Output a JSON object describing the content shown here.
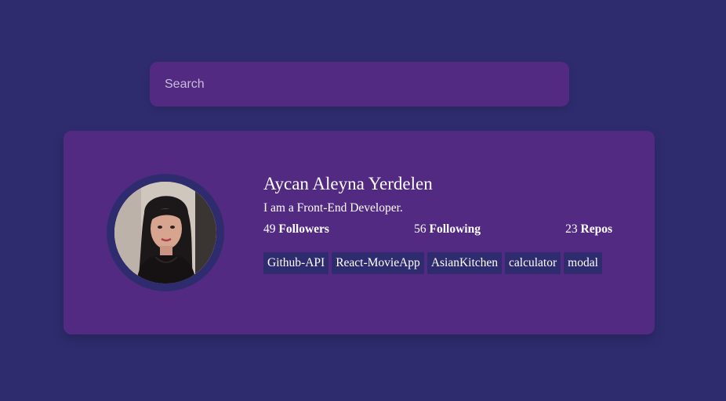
{
  "search": {
    "placeholder": "Search",
    "value": ""
  },
  "user": {
    "name": "Aycan Aleyna Yerdelen",
    "bio": "I am a Front-End Developer.",
    "avatar_icon": "profile-photo"
  },
  "stats": {
    "followers": {
      "count": "49",
      "label": "Followers"
    },
    "following": {
      "count": "56",
      "label": "Following"
    },
    "repos": {
      "count": "23",
      "label": "Repos"
    }
  },
  "repos": [
    {
      "name": "Github-API"
    },
    {
      "name": "React-MovieApp"
    },
    {
      "name": "AsianKitchen"
    },
    {
      "name": "calculator"
    },
    {
      "name": "modal"
    }
  ],
  "colors": {
    "page_background": "#2e2c6e",
    "card_background": "#522a82",
    "repo_background": "#2e2c6e",
    "text": "#ffffff"
  }
}
